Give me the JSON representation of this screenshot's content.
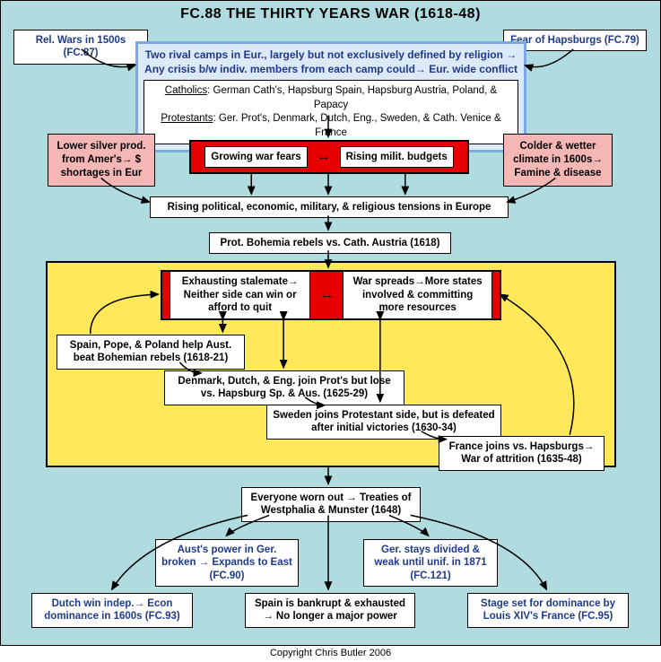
{
  "title": "FC.88 THE THIRTY YEARS WAR (1618-48)",
  "top_left_link": "Rel. Wars in 1500s (FC.87)",
  "top_right_link": "Fear of Hapsburgs (FC.79)",
  "camps_head_l1": "Two rival camps in Eur., largely but not exclusively defined by religion →",
  "camps_head_l2": "Any crisis b/w indiv. members from each camp could→ Eur. wide conflict",
  "camps_cath": "Catholics: German Cath's, Hapsburg Spain, Hapsburg Austria, Poland, & Papacy",
  "camps_prot": "Protestants: Ger. Prot's, Denmark, Dutch, Eng., Sweden, & Cath. Venice & France",
  "silver": "Lower silver prod. from Amer's→ $ shortages in Eur",
  "climate": "Colder & wetter climate in 1600s→ Famine & disease",
  "fears": "Growing war fears",
  "budgets": "Rising milit. budgets",
  "tensions": "Rising political, economic, military, & religious tensions in Europe",
  "bohemia": "Prot. Bohemia rebels vs. Cath. Austria (1618)",
  "stalemate": "Exhausting stalemate→ Neither side can win or afford to quit",
  "spreads": "War spreads→More states involved & committing more resources",
  "spain_help": "Spain, Pope, & Poland help Aust. beat Bohemian rebels (1618-21)",
  "denmark": "Denmark, Dutch, & Eng. join Prot's but lose vs. Hapsburg Sp. & Aus. (1625-29)",
  "sweden": "Sweden joins Protestant side, but is defeated after initial victories (1630-34)",
  "france_joins": "France joins vs. Hapsburgs→ War of attrition (1635-48)",
  "westphalia": "Everyone worn out → Treaties of Westphalia & Munster (1648)",
  "aust": "Aust's power in Ger. broken → Expands to East (FC.90)",
  "ger_div": "Ger. stays divided & weak until unif. in 1871 (FC.121)",
  "dutch": "Dutch win indep.→ Econ dominance in 1600s (FC.93)",
  "spain_bankrupt": "Spain is bankrupt & exhausted → No longer a major power",
  "louis": "Stage set for dominance by Louis XIV's France (FC.95)",
  "copyright": "Copyright Chris Butler 2006"
}
